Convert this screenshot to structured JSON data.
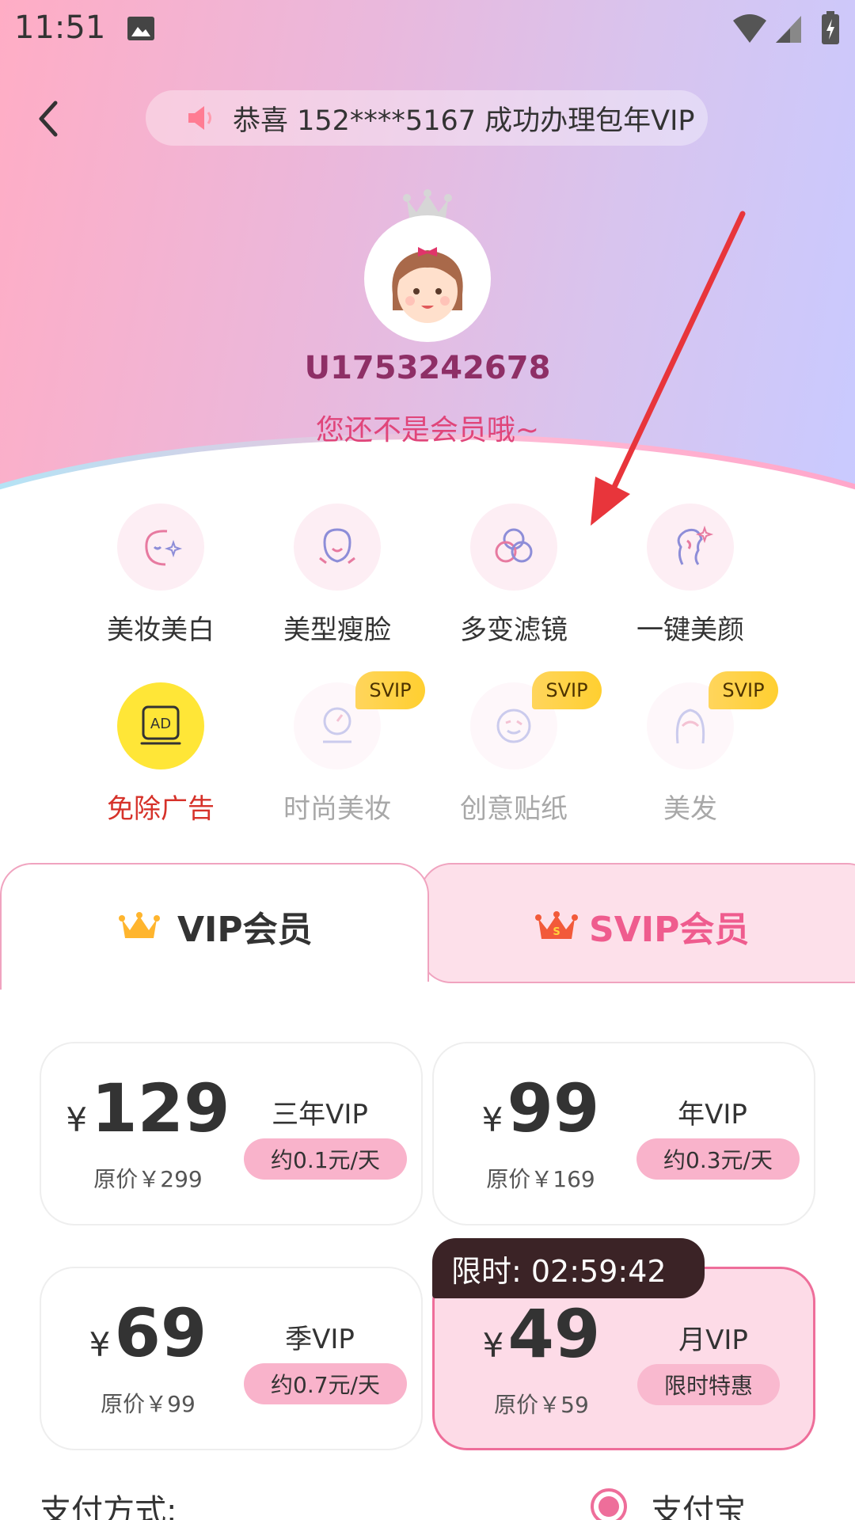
{
  "status_bar": {
    "time": "11:51"
  },
  "notice": {
    "text": "恭喜 152****5167 成功办理包年VIP"
  },
  "user": {
    "id": "U1753242678",
    "status": "您还不是会员哦~"
  },
  "features": [
    {
      "label": "美妆美白",
      "icon": "face-sparkle-icon"
    },
    {
      "label": "美型瘦脸",
      "icon": "face-slim-icon"
    },
    {
      "label": "多变滤镜",
      "icon": "filter-circles-icon"
    },
    {
      "label": "一键美颜",
      "icon": "beauty-profile-icon"
    },
    {
      "label": "免除广告",
      "icon": "ad-icon"
    },
    {
      "label": "时尚美妆",
      "icon": "mirror-icon",
      "badge": "SVIP"
    },
    {
      "label": "创意贴纸",
      "icon": "sticker-face-icon",
      "badge": "SVIP"
    },
    {
      "label": "美发",
      "icon": "hair-icon",
      "badge": "SVIP"
    }
  ],
  "tabs": {
    "vip": "VIP会员",
    "svip": "SVIP会员"
  },
  "plans": [
    {
      "currency": "¥",
      "price": "129",
      "original": "原价￥299",
      "name": "三年VIP",
      "tag": "约0.1元/天"
    },
    {
      "currency": "¥",
      "price": "99",
      "original": "原价￥169",
      "name": "年VIP",
      "tag": "约0.3元/天"
    },
    {
      "currency": "¥",
      "price": "69",
      "original": "原价￥99",
      "name": "季VIP",
      "tag": "约0.7元/天"
    },
    {
      "currency": "¥",
      "price": "49",
      "original": "原价￥59",
      "name": "月VIP",
      "tag": "限时特惠"
    }
  ],
  "timer": "限时: 02:59:42",
  "payment": {
    "label": "支付方式:",
    "method": "支付宝"
  },
  "colors": {
    "accent": "#ee6e9a",
    "ad_yellow": "#ffe637",
    "annotation_arrow": "#e8353b"
  }
}
